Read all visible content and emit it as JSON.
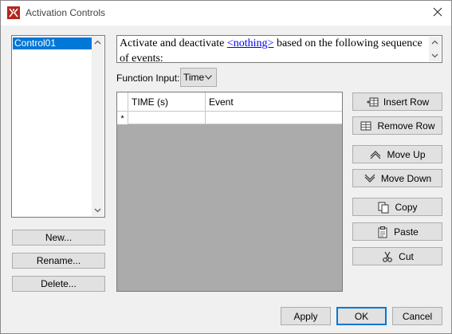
{
  "window": {
    "title": "Activation Controls"
  },
  "controls_list": {
    "items": [
      {
        "label": "Control01",
        "selected": true
      }
    ]
  },
  "left_buttons": {
    "new": "New...",
    "rename": "Rename...",
    "delete": "Delete..."
  },
  "description": {
    "prefix": "Activate and deactivate",
    "link": "<nothing>",
    "suffix": "based on the following sequence of events:"
  },
  "function_input": {
    "label": "Function Input:",
    "value": "Time"
  },
  "table": {
    "columns": [
      "TIME (s)",
      "Event"
    ],
    "new_row_marker": "*"
  },
  "right_buttons": {
    "insert_row": "Insert Row",
    "remove_row": "Remove Row",
    "move_up": "Move Up",
    "move_down": "Move Down",
    "copy": "Copy",
    "paste": "Paste",
    "cut": "Cut"
  },
  "footer": {
    "apply": "Apply",
    "ok": "OK",
    "cancel": "Cancel"
  },
  "colors": {
    "selection": "#0078d7",
    "link": "#0000ee",
    "app_icon": "#c0392b"
  }
}
